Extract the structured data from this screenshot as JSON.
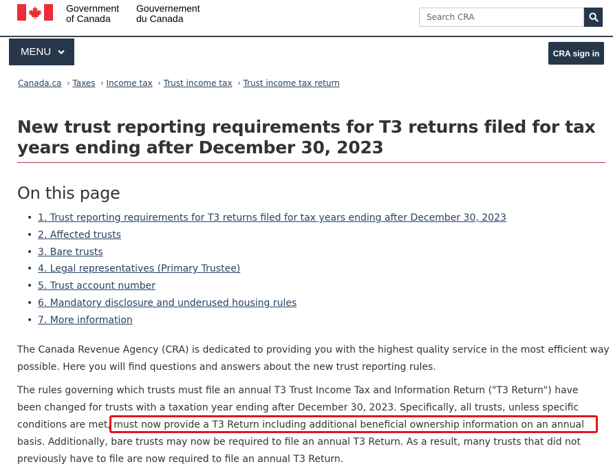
{
  "header": {
    "signature_en_line1": "Government",
    "signature_en_line2": "of Canada",
    "signature_fr_line1": "Gouvernement",
    "signature_fr_line2": "du Canada",
    "search_placeholder": "Search CRA",
    "menu_label": "MENU",
    "signin_label": "CRA sign in",
    "flag_color": "#eb2d37"
  },
  "breadcrumb": [
    "Canada.ca",
    "Taxes",
    "Income tax",
    "Trust income tax",
    "Trust income tax return"
  ],
  "page_title": "New trust reporting requirements for T3 returns filed for tax years ending after December 30, 2023",
  "on_this_page": {
    "heading": "On this page",
    "items": [
      "1. Trust reporting requirements for T3 returns filed for tax years ending after December 30, 2023",
      "2. Affected trusts",
      "3. Bare trusts",
      "4. Legal representatives (Primary Trustee)",
      "5. Trust account number",
      "6. Mandatory disclosure and underused housing rules",
      "7. More information"
    ]
  },
  "paragraph1": [
    "The Canada Revenue Agency (CRA) is dedicated to providing you with the highest quality service in the most efficient way",
    "possible. Here you will find questions and answers about the new trust reporting rules."
  ],
  "paragraph2": [
    "The rules governing which trusts must file an annual T3 Trust Income Tax and Information Return (\"T3 Return\") have",
    "been changed for trusts with a taxation year ending after December 30, 2023. Specifically, all trusts, unless specific",
    "conditions are met, must now provide a T3 Return including additional beneficial ownership information on an annual",
    "basis. Additionally, bare trusts may now be required to file an annual T3 Return. As a result, many trusts that did not",
    "previously have to file are now required to file an annual T3 Return."
  ],
  "colors": {
    "brand_navy": "#26374a",
    "link": "#284162",
    "rule_red": "#af3c43",
    "highlight_red": "#e0161d"
  }
}
